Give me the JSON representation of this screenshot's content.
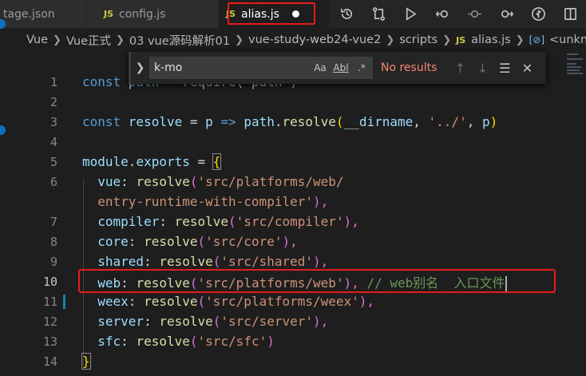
{
  "tabs": [
    {
      "label": "tage.json",
      "icon": "json-file-icon"
    },
    {
      "label": "config.js",
      "icon": "js-file-icon"
    },
    {
      "label": "alias.js",
      "icon": "js-file-icon",
      "active": true
    }
  ],
  "js_badge": "JS",
  "breadcrumb": [
    "Vue",
    "Vue正式",
    "03 vue源码解析01",
    "vue-study-web24-vue2",
    "scripts",
    "alias.js",
    "<unknown>"
  ],
  "breadcrumb_symbol": "[⊘]",
  "find": {
    "query": "k-mo",
    "opt_case": "Aa",
    "opt_word": "Abl",
    "opt_regex": ".*",
    "status": "No results"
  },
  "line_numbers": [
    "1",
    "2",
    "3",
    "4",
    "5",
    "6",
    "",
    "7",
    "8",
    "9",
    "10",
    "11",
    "12",
    "13",
    "14"
  ],
  "code": {
    "l1_kw": "const ",
    "l1_var": "path",
    "l1_rest": " = require('path')",
    "l3_kw": "const ",
    "l3_var": "resolve",
    "l3_eq": " = ",
    "l3_p": "p",
    "l3_arrow": " => ",
    "l3_path": "path",
    "l3_dot": ".",
    "l3_fn": "resolve",
    "l3_open": "(",
    "l3_dirname": "__dirname",
    "l3_comma": ", ",
    "l3_str": "'../'",
    "l3_comma2": ", ",
    "l3_p2": "p",
    "l3_close": ")",
    "l5_module": "module",
    "l5_dot": ".",
    "l5_exports": "exports",
    "l5_eq": " = ",
    "l5_brace": "{",
    "entries": [
      {
        "key": "vue",
        "str": "'src/platforms/web/",
        "cont": "entry-runtime-with-compiler'",
        "end": "),"
      },
      {
        "key": "compiler",
        "str": "'src/compiler'",
        "end": "),"
      },
      {
        "key": "core",
        "str": "'src/core'",
        "end": "),"
      },
      {
        "key": "shared",
        "str": "'src/shared'",
        "end": "),"
      },
      {
        "key": "web",
        "str": "'src/platforms/web'",
        "end": "), ",
        "comment": "// web别名  入口文件"
      },
      {
        "key": "weex",
        "str": "'src/platforms/weex'",
        "end": "),"
      },
      {
        "key": "server",
        "str": "'src/server'",
        "end": "),"
      },
      {
        "key": "sfc",
        "str": "'src/sfc'",
        "end": ")"
      }
    ],
    "colon": ": ",
    "resolve": "resolve",
    "paren_open": "(",
    "close_brace": "}"
  }
}
